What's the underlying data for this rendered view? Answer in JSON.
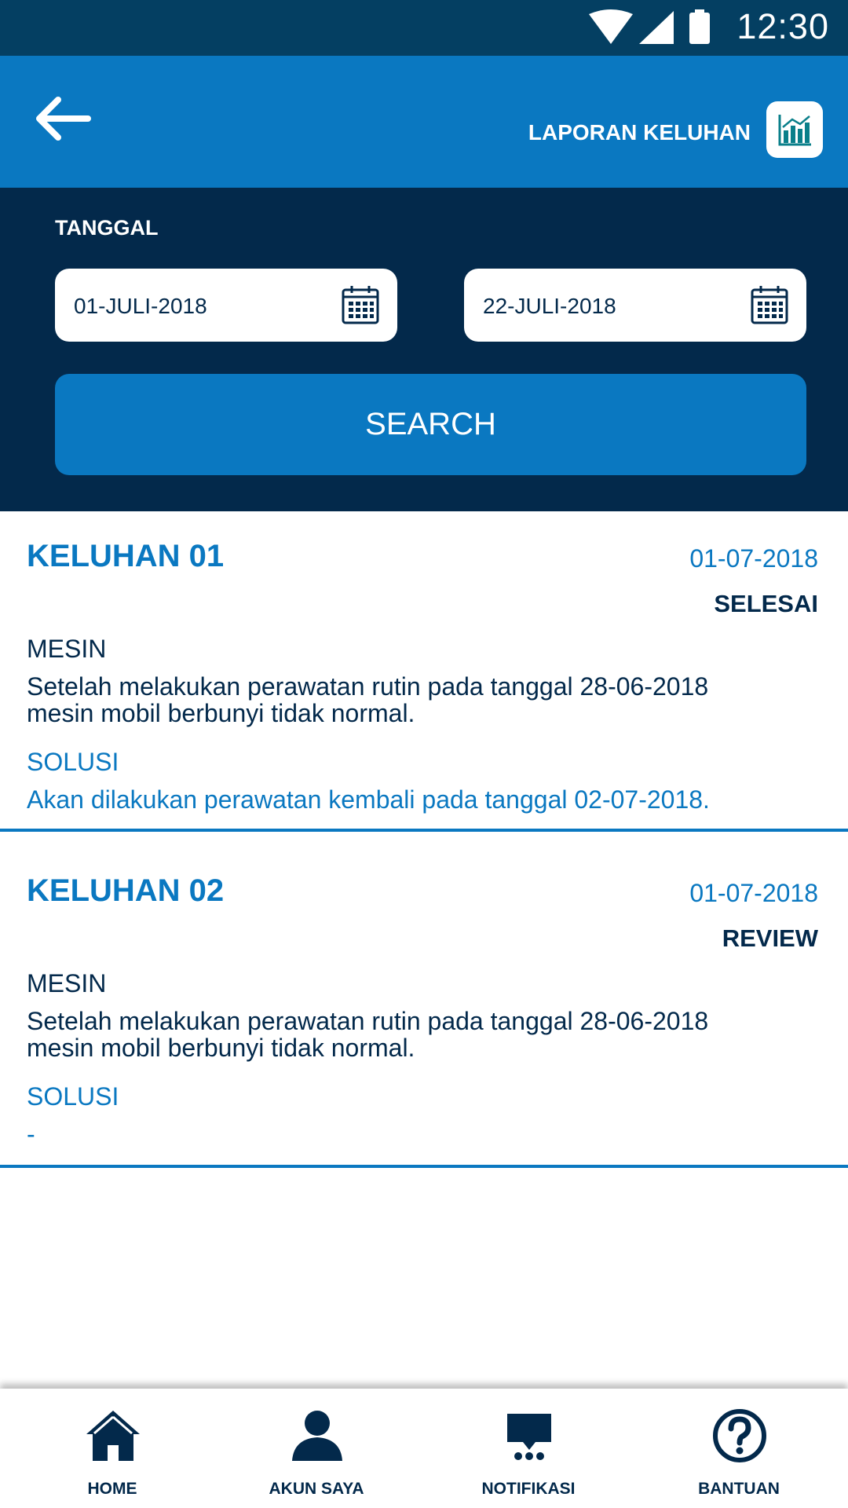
{
  "status_bar": {
    "time": "12:30"
  },
  "header": {
    "title": "LAPORAN KELUHAN",
    "back_icon": "arrow-left-icon",
    "report_icon": "bar-chart-icon"
  },
  "filter": {
    "label": "TANGGAL",
    "start_date": "01-JULI-2018",
    "end_date": "22-JULI-2018",
    "search_label": "SEARCH"
  },
  "complaints": [
    {
      "title": "KELUHAN 01",
      "date": "01-07-2018",
      "status": "SELESAI",
      "category": "MESIN",
      "description_line1": "Setelah melakukan perawatan rutin pada tanggal 28-06-2018",
      "description_line2": "mesin mobil berbunyi tidak normal.",
      "solution_label": "SOLUSI",
      "solution": "Akan dilakukan perawatan kembali pada tanggal 02-07-2018."
    },
    {
      "title": "KELUHAN 02",
      "date": "01-07-2018",
      "status": "REVIEW",
      "category": "MESIN",
      "description_line1": "Setelah melakukan perawatan rutin pada tanggal 28-06-2018",
      "description_line2": "mesin mobil berbunyi tidak normal.",
      "solution_label": "SOLUSI",
      "solution": "-"
    }
  ],
  "bottom_nav": [
    {
      "label": "HOME",
      "icon": "home-icon"
    },
    {
      "label": "AKUN SAYA",
      "icon": "user-icon"
    },
    {
      "label": "NOTIFIKASI",
      "icon": "chat-icon"
    },
    {
      "label": "BANTUAN",
      "icon": "help-icon"
    }
  ],
  "colors": {
    "primary": "#0a78c1",
    "dark": "#03294b",
    "statusbar": "#043f62"
  }
}
